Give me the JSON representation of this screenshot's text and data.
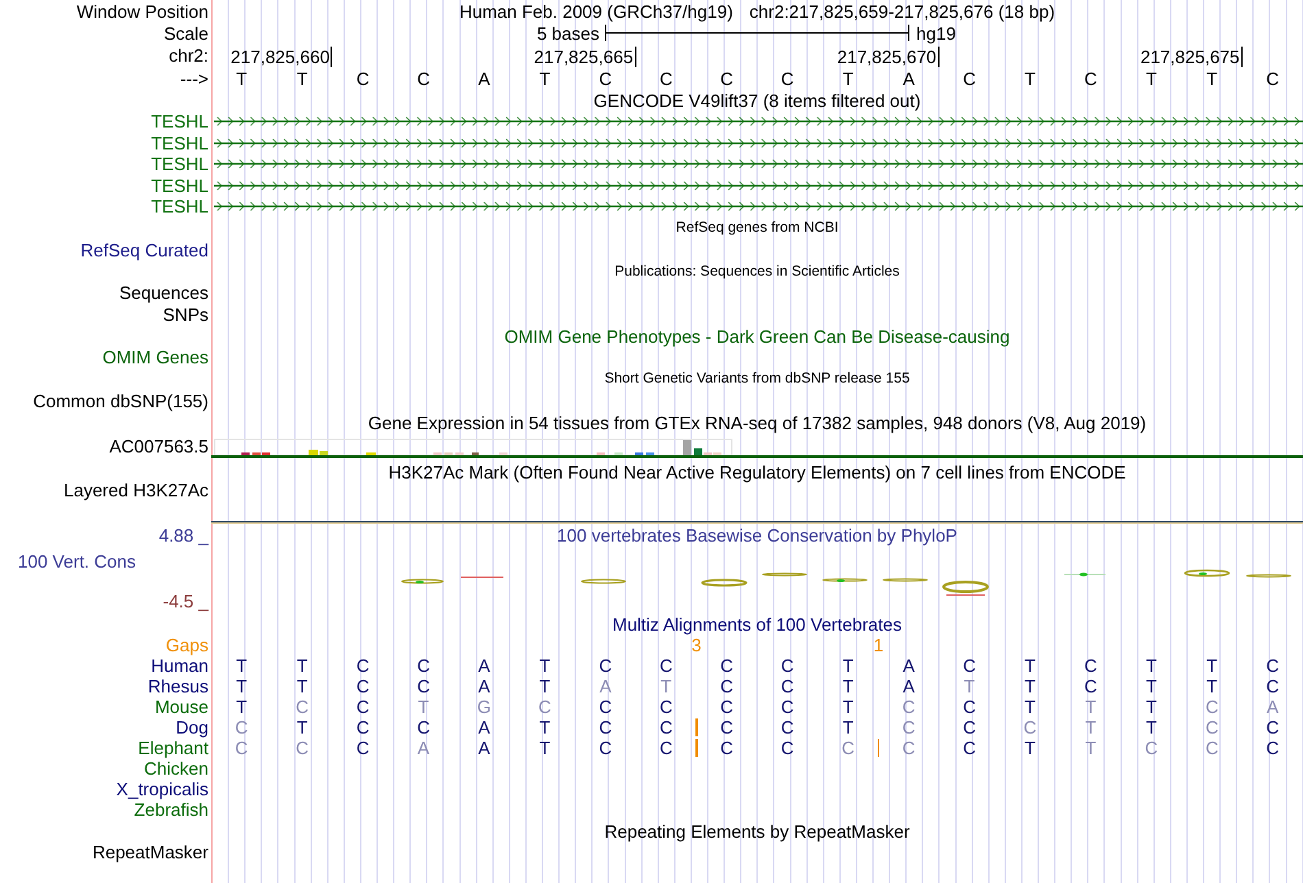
{
  "header": {
    "label": "Window Position",
    "assembly": "Human Feb. 2009 (GRCh37/hg19)",
    "position": "chr2:217,825,659-217,825,676 (18 bp)"
  },
  "scale": {
    "label": "Scale",
    "length": "5 bases",
    "assembly": "hg19"
  },
  "ruler": {
    "label": "chr2:",
    "ticks": [
      "217,825,660",
      "217,825,665",
      "217,825,670",
      "217,825,675"
    ]
  },
  "sequence": {
    "label": "--->",
    "bases": [
      "T",
      "T",
      "C",
      "C",
      "A",
      "T",
      "C",
      "C",
      "C",
      "C",
      "T",
      "A",
      "C",
      "T",
      "C",
      "T",
      "T",
      "C"
    ]
  },
  "tracks": [
    {
      "kind": "genes",
      "title": {
        "text": "GENCODE V49lift37 (8 items filtered out)"
      },
      "color": "#137313",
      "items": [
        {
          "label": "TESHL"
        },
        {
          "label": "TESHL"
        },
        {
          "label": "TESHL"
        },
        {
          "label": "TESHL"
        },
        {
          "label": "TESHL"
        }
      ]
    },
    {
      "kind": "note",
      "title": {
        "text": "RefSeq genes from NCBI"
      },
      "color": "#1c1c8a",
      "labels": [
        "RefSeq Curated"
      ]
    },
    {
      "kind": "note",
      "title": {
        "text": "Publications: Sequences in Scientific Articles"
      },
      "labels": [
        "Sequences",
        "SNPs"
      ]
    },
    {
      "kind": "empty",
      "title": {
        "text": "OMIM Gene Phenotypes - Dark Green Can Be Disease-causing",
        "color": "#0b640b"
      },
      "color": "#0b640b",
      "labels": [
        "OMIM Genes"
      ]
    },
    {
      "kind": "note",
      "title": {
        "text": "Short Genetic Variants from dbSNP release 155"
      },
      "labels": [
        "Common dbSNP(155)"
      ]
    },
    {
      "kind": "expression",
      "title": {
        "text": "Gene Expression in 54 tissues from GTEx RNA-seq of 17382 samples, 948 donors (V8, Aug 2019)"
      },
      "labels": [
        "AC007563.5"
      ]
    },
    {
      "kind": "signal",
      "title": {
        "text": "H3K27Ac Mark (Often Found Near Active Regulatory Elements) on 7 cell lines from ENCODE"
      },
      "labels": [
        "Layered H3K27Ac"
      ]
    },
    {
      "kind": "conservation",
      "title": {
        "text": "100 vertebrates Basewise Conservation by PhyloP",
        "color": "#3c3c96"
      },
      "color": "#3c3c96",
      "labels": [
        "100 Vert. Cons"
      ],
      "max": "4.88 _",
      "min": "-4.5 _"
    },
    {
      "kind": "alignment",
      "title": {
        "text": "Multiz Alignments of 100 Vertebrates",
        "color": "#0c0c78"
      },
      "gaps": {
        "label": "Gaps",
        "counts": [
          "3",
          "1"
        ]
      },
      "species": [
        {
          "name": "Human",
          "color": "#0c0c78",
          "bases": [
            {
              "base": "T",
              "match": true,
              "insertion": false
            },
            {
              "base": "T",
              "match": true,
              "insertion": false
            },
            {
              "base": "C",
              "match": true,
              "insertion": false
            },
            {
              "base": "C",
              "match": true,
              "insertion": false
            },
            {
              "base": "A",
              "match": true,
              "insertion": false
            },
            {
              "base": "T",
              "match": true,
              "insertion": false
            },
            {
              "base": "C",
              "match": true,
              "insertion": false
            },
            {
              "base": "C",
              "match": true,
              "insertion": false
            },
            {
              "base": "C",
              "match": true,
              "insertion": false
            },
            {
              "base": "C",
              "match": true,
              "insertion": false
            },
            {
              "base": "T",
              "match": true,
              "insertion": false
            },
            {
              "base": "A",
              "match": true,
              "insertion": false
            },
            {
              "base": "C",
              "match": true,
              "insertion": false
            },
            {
              "base": "T",
              "match": true,
              "insertion": false
            },
            {
              "base": "C",
              "match": true,
              "insertion": false
            },
            {
              "base": "T",
              "match": true,
              "insertion": false
            },
            {
              "base": "T",
              "match": true,
              "insertion": false
            },
            {
              "base": "C",
              "match": true,
              "insertion": false
            }
          ]
        },
        {
          "name": "Rhesus",
          "color": "#0c0c78",
          "bases": [
            {
              "base": "T",
              "match": true,
              "insertion": false
            },
            {
              "base": "T",
              "match": true,
              "insertion": false
            },
            {
              "base": "C",
              "match": true,
              "insertion": false
            },
            {
              "base": "C",
              "match": true,
              "insertion": false
            },
            {
              "base": "A",
              "match": true,
              "insertion": false
            },
            {
              "base": "T",
              "match": true,
              "insertion": false
            },
            {
              "base": "A",
              "match": false,
              "insertion": false
            },
            {
              "base": "T",
              "match": false,
              "insertion": false
            },
            {
              "base": "C",
              "match": true,
              "insertion": false
            },
            {
              "base": "C",
              "match": true,
              "insertion": false
            },
            {
              "base": "T",
              "match": true,
              "insertion": false
            },
            {
              "base": "A",
              "match": true,
              "insertion": false
            },
            {
              "base": "T",
              "match": false,
              "insertion": false
            },
            {
              "base": "T",
              "match": true,
              "insertion": false
            },
            {
              "base": "C",
              "match": true,
              "insertion": false
            },
            {
              "base": "T",
              "match": true,
              "insertion": false
            },
            {
              "base": "T",
              "match": true,
              "insertion": false
            },
            {
              "base": "C",
              "match": true,
              "insertion": false
            }
          ]
        },
        {
          "name": "Mouse",
          "color": "#0c6c0c",
          "bases": [
            {
              "base": "T",
              "match": true,
              "insertion": false
            },
            {
              "base": "C",
              "match": false,
              "insertion": false
            },
            {
              "base": "C",
              "match": true,
              "insertion": false
            },
            {
              "base": "T",
              "match": false,
              "insertion": false
            },
            {
              "base": "G",
              "match": false,
              "insertion": false
            },
            {
              "base": "C",
              "match": false,
              "insertion": false
            },
            {
              "base": "C",
              "match": true,
              "insertion": false
            },
            {
              "base": "C",
              "match": true,
              "insertion": false
            },
            {
              "base": "C",
              "match": true,
              "insertion": false
            },
            {
              "base": "C",
              "match": true,
              "insertion": false
            },
            {
              "base": "T",
              "match": true,
              "insertion": false
            },
            {
              "base": "C",
              "match": false,
              "insertion": false
            },
            {
              "base": "C",
              "match": true,
              "insertion": false
            },
            {
              "base": "T",
              "match": true,
              "insertion": false
            },
            {
              "base": "T",
              "match": false,
              "insertion": false
            },
            {
              "base": "T",
              "match": true,
              "insertion": false
            },
            {
              "base": "C",
              "match": false,
              "insertion": false
            },
            {
              "base": "A",
              "match": false,
              "insertion": false
            }
          ]
        },
        {
          "name": "Dog",
          "color": "#0c0c78",
          "bases": [
            {
              "base": "C",
              "match": false,
              "insertion": false
            },
            {
              "base": "T",
              "match": true,
              "insertion": false
            },
            {
              "base": "C",
              "match": true,
              "insertion": false
            },
            {
              "base": "C",
              "match": true,
              "insertion": false
            },
            {
              "base": "A",
              "match": true,
              "insertion": false
            },
            {
              "base": "T",
              "match": true,
              "insertion": false
            },
            {
              "base": "C",
              "match": true,
              "insertion": false
            },
            {
              "base": "C",
              "match": true,
              "insertion": true
            },
            {
              "base": "C",
              "match": true,
              "insertion": false
            },
            {
              "base": "C",
              "match": true,
              "insertion": false
            },
            {
              "base": "T",
              "match": true,
              "insertion": false
            },
            {
              "base": "C",
              "match": false,
              "insertion": false
            },
            {
              "base": "C",
              "match": true,
              "insertion": false
            },
            {
              "base": "C",
              "match": false,
              "insertion": false
            },
            {
              "base": "T",
              "match": false,
              "insertion": false
            },
            {
              "base": "T",
              "match": true,
              "insertion": false
            },
            {
              "base": "C",
              "match": false,
              "insertion": false
            },
            {
              "base": "C",
              "match": true,
              "insertion": false
            }
          ]
        },
        {
          "name": "Elephant",
          "color": "#0c6c0c",
          "bases": [
            {
              "base": "C",
              "match": false,
              "insertion": false
            },
            {
              "base": "C",
              "match": false,
              "insertion": false
            },
            {
              "base": "C",
              "match": true,
              "insertion": false
            },
            {
              "base": "A",
              "match": false,
              "insertion": false
            },
            {
              "base": "A",
              "match": true,
              "insertion": false
            },
            {
              "base": "T",
              "match": true,
              "insertion": false
            },
            {
              "base": "C",
              "match": true,
              "insertion": false
            },
            {
              "base": "C",
              "match": true,
              "insertion": true
            },
            {
              "base": "C",
              "match": true,
              "insertion": false
            },
            {
              "base": "C",
              "match": true,
              "insertion": false
            },
            {
              "base": "C",
              "match": false,
              "insertion": true
            },
            {
              "base": "C",
              "match": false,
              "insertion": false
            },
            {
              "base": "C",
              "match": true,
              "insertion": false
            },
            {
              "base": "T",
              "match": true,
              "insertion": false
            },
            {
              "base": "T",
              "match": false,
              "insertion": false
            },
            {
              "base": "C",
              "match": false,
              "insertion": false
            },
            {
              "base": "C",
              "match": false,
              "insertion": false
            },
            {
              "base": "C",
              "match": true,
              "insertion": false
            }
          ]
        },
        {
          "name": "Chicken",
          "color": "#0c6c0c"
        },
        {
          "name": "X_tropicalis",
          "color": "#0c0c78"
        },
        {
          "name": "Zebrafish",
          "color": "#0c6c0c"
        }
      ]
    },
    {
      "kind": "empty",
      "title": {
        "text": "Repeating Elements by RepeatMasker"
      },
      "labels": [
        "RepeatMasker"
      ]
    }
  ]
}
